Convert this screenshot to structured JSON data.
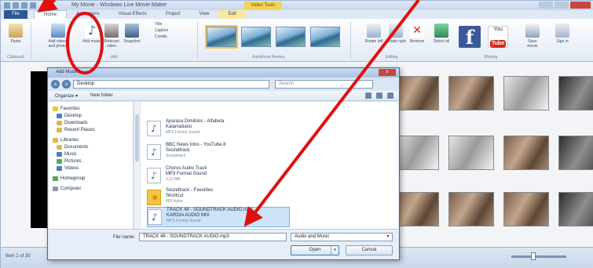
{
  "app": {
    "title": "My Movie - Windows Live Movie Maker",
    "context_tab": "Video Tools",
    "tabs": [
      "Home",
      "Animations",
      "Visual Effects",
      "Project",
      "View",
      "Edit"
    ],
    "file_tab": "File",
    "ribbon": {
      "paste_label": "Paste",
      "add_videos_label": "Add videos and photos",
      "add_music_label": "Add music",
      "webcam_label": "Webcam video",
      "snapshot_label": "Snapshot",
      "small_buttons": [
        "Title",
        "Caption",
        "Credits"
      ],
      "group_clipboard": "Clipboard",
      "group_add": "Add",
      "group_themes": "AutoMovie themes",
      "group_editing": "Editing",
      "group_sharing": "Sharing",
      "rotate_left": "Rotate left",
      "rotate_right": "Rotate right",
      "remove_label": "Remove",
      "select_all": "Select all",
      "facebook_letter": "f",
      "youtube_you": "You",
      "youtube_tube": "Tube",
      "save_movie_label": "Save movie",
      "sign_in_label": "Sign in"
    },
    "status_text": "Item 1 of 30"
  },
  "dialog": {
    "title": "Add Music",
    "close_label": "x",
    "address": "Desktop",
    "search_placeholder": "Search",
    "toolbar": {
      "organize": "Organize ▾",
      "new_folder": "New folder"
    },
    "nav": {
      "favorites_header": "Favorites",
      "favorites": [
        "Desktop",
        "Downloads",
        "Recent Places"
      ],
      "libraries_header": "Libraries",
      "libraries": [
        "Documents",
        "Music",
        "Pictures",
        "Videos"
      ],
      "homegroup": "Homegroup",
      "computer": "Computer"
    },
    "files": [
      {
        "name": "Aparasa Dimitrios - Alfabeta",
        "line2": "Kalamatiano",
        "meta": "MP3 Format Sound"
      },
      {
        "name": "BBC News Intro - YouTube.8",
        "line2": "Soundtrack",
        "meta": "Soundtrack"
      },
      {
        "name": "Chorus Audio Track",
        "line2": "MP3 Format Sound",
        "meta": "3.21 MB"
      },
      {
        "name": "Soundtrack - Favorites",
        "line2": "Shortcut",
        "meta": "869 bytes"
      },
      {
        "name": "TRACK 48 - SOUNDTRACK AUDIO.mp3",
        "line2": "KARDIA AUDIO MIX",
        "meta": "MP3 Format Sound"
      }
    ],
    "filename_label": "File name:",
    "filename_value": "TRACK 48 - SOUNDTRACK AUDIO.mp3",
    "filetype_value": "Audio and Music",
    "open_label": "Open",
    "cancel_label": "Cancel"
  },
  "colors": {
    "annotation_red": "#e01010",
    "accent_blue": "#2b5797",
    "facebook_blue": "#3b5998",
    "youtube_red": "#d42a22"
  }
}
